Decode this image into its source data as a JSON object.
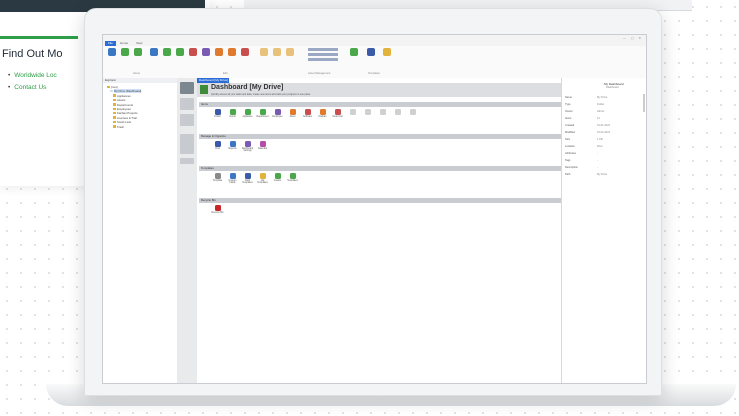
{
  "left_card": {
    "heading": "Find Out Mo",
    "links": [
      "Worldwide Loc",
      "Contact Us"
    ]
  },
  "app": {
    "tabs": [
      "File",
      "Home",
      "View"
    ],
    "ribbon_groups": [
      "Home",
      "Edit",
      "Asset Management",
      "Templates"
    ],
    "sidebar_header": "Explorer",
    "tree": [
      "[root]",
      "My Drive (Dashboard)",
      "Appliances",
      "Assets",
      "Departments",
      "Employees",
      "Kanban Projects",
      "Licenses & Trial",
      "Smart Lists",
      "Trash"
    ],
    "strip_buttons": [
      "Dashboard",
      "Items",
      "Reports",
      "Calendar",
      "Search"
    ],
    "doc_tab": "Dashboard [My Drive]",
    "title": "Dashboard [My Drive]",
    "subtitle": "Quickly access all your tasks and data, create new items and track your progress in one place",
    "sections": [
      {
        "name": "Items",
        "items": [
          "Folder",
          "Import",
          "Appliance",
          "Department",
          "Employee",
          "Asset",
          "Software",
          "Kanban",
          "Smart List",
          "",
          "",
          "",
          "",
          ""
        ]
      },
      {
        "name": "Manage & Organize",
        "items": [
          "Find",
          "Reports",
          "Dashboard Settings",
          "Calendar"
        ]
      },
      {
        "name": "Templates",
        "items": [
          "Template",
          "Custom Fields",
          "Field Templates",
          "List Templates",
          "Assets",
          "Templates"
        ]
      },
      {
        "name": "Recycle Bin",
        "items": [
          "Recycle Bin"
        ]
      }
    ],
    "properties": {
      "title": "My Dashboard",
      "subtitle": "Dashboard",
      "rows": [
        {
          "label": "Name",
          "value": "My Drive"
        },
        {
          "label": "Type",
          "value": "Folder"
        },
        {
          "label": "Owner",
          "value": "Admin"
        },
        {
          "label": "Items",
          "value": "12"
        },
        {
          "label": "Created",
          "value": "01.01.2024"
        },
        {
          "label": "Modified",
          "value": "01.02.2024"
        },
        {
          "label": "Size",
          "value": "1 KB"
        },
        {
          "label": "Location",
          "value": "Root"
        },
        {
          "label": "Attributes",
          "value": "-"
        },
        {
          "label": "Tags",
          "value": "-"
        },
        {
          "label": "Description",
          "value": "-"
        },
        {
          "label": "Path",
          "value": "My Drive"
        }
      ]
    }
  },
  "colors": {
    "accent": "#2b6cd6",
    "brand_green": "#2e9e48",
    "dark": "#2b3a42"
  }
}
